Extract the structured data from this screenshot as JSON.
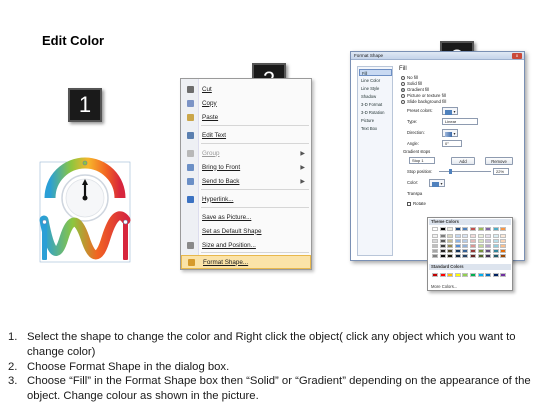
{
  "title": "Edit Color",
  "markers": [
    "1",
    "2",
    "3"
  ],
  "context_menu": {
    "items": [
      {
        "label": "Cut",
        "icon": "scissors-icon",
        "color": "#6d6d6d",
        "disabled": false
      },
      {
        "label": "Copy",
        "icon": "copy-icon",
        "color": "#7b93c6",
        "disabled": false
      },
      {
        "label": "Paste",
        "icon": "paste-icon",
        "color": "#caa64a",
        "disabled": false
      },
      {
        "label": "Edit Text",
        "icon": "edit-text-icon",
        "color": "#5a7fb0",
        "disabled": false
      },
      {
        "label": "Group",
        "icon": "group-icon",
        "color": "#b8b8b8",
        "disabled": true,
        "submenu": true
      },
      {
        "label": "Bring to Front",
        "icon": "bring-to-front-icon",
        "color": "#6b8fc6",
        "disabled": false,
        "submenu": true
      },
      {
        "label": "Send to Back",
        "icon": "send-to-back-icon",
        "color": "#6b8fc6",
        "disabled": false,
        "submenu": true
      },
      {
        "label": "Hyperlink...",
        "icon": "hyperlink-icon",
        "color": "#3b72c2",
        "disabled": false
      },
      {
        "label": "Save as Picture...",
        "icon": "",
        "color": "",
        "disabled": false
      },
      {
        "label": "Set as Default Shape",
        "icon": "",
        "color": "",
        "disabled": false
      },
      {
        "label": "Size and Position...",
        "icon": "size-position-icon",
        "color": "#8a8a8a",
        "disabled": false
      },
      {
        "label": "Format Shape...",
        "icon": "format-shape-icon",
        "color": "#d69a2c",
        "disabled": false,
        "highlighted": true
      }
    ]
  },
  "format_dialog": {
    "title": "Format Shape",
    "close_label": "x",
    "nav": [
      "Fill",
      "Line Color",
      "Line Style",
      "Shadow",
      "3-D Format",
      "3-D Rotation",
      "Picture",
      "Text Box"
    ],
    "section_title": "Fill",
    "fill_options": [
      {
        "label": "No fill",
        "checked": false
      },
      {
        "label": "Solid fill",
        "checked": false
      },
      {
        "label": "Gradient fill",
        "checked": true
      },
      {
        "label": "Picture or texture fill",
        "checked": false
      },
      {
        "label": "Slide background fill",
        "checked": false
      }
    ],
    "preset_colors_label": "Preset colors:",
    "type_label": "Type:",
    "type_value": "Linear",
    "direction_label": "Direction:",
    "angle_label": "Angle:",
    "angle_value": "0°",
    "gradient_stops_label": "Gradient stops",
    "stop_value": "Stop 1",
    "add_label": "Add",
    "remove_label": "Remove",
    "stop_position_label": "Stop position:",
    "stop_position_value": "22%",
    "color_label": "Color:",
    "transparency_label": "Transpa",
    "rotate_label": "Rotate",
    "accent": "#4f81bd"
  },
  "palette": {
    "theme_title": "Theme Colors",
    "standard_title": "Standard Colors",
    "more_label": "More Colors...",
    "theme_top": [
      "#ffffff",
      "#000000",
      "#eeece1",
      "#1f497d",
      "#4f81bd",
      "#c0504d",
      "#9bbb59",
      "#8064a2",
      "#4bacc6",
      "#f79646"
    ],
    "theme_shades": [
      [
        "#f2f2f2",
        "#7f7f7f",
        "#ddd9c3",
        "#c6d9f0",
        "#dbe5f1",
        "#f2dcdb",
        "#ebf1dd",
        "#e5e0ec",
        "#dbeef3",
        "#fdeada"
      ],
      [
        "#d8d8d8",
        "#595959",
        "#c4bd97",
        "#8db3e2",
        "#b8cce4",
        "#e5b9b7",
        "#d7e3bc",
        "#ccc1d9",
        "#b7dde8",
        "#fbd5b5"
      ],
      [
        "#bfbfbf",
        "#3f3f3f",
        "#938953",
        "#548dd4",
        "#95b3d7",
        "#d99694",
        "#c3d69b",
        "#b2a2c7",
        "#92cddc",
        "#fac08f"
      ],
      [
        "#a5a5a5",
        "#262626",
        "#494429",
        "#17365d",
        "#366092",
        "#953734",
        "#76923c",
        "#5f497a",
        "#31859b",
        "#e36c09"
      ],
      [
        "#7f7f7f",
        "#0c0c0c",
        "#1d1b10",
        "#0f243e",
        "#244061",
        "#632423",
        "#4f6128",
        "#3f3151",
        "#205867",
        "#974806"
      ]
    ],
    "standard": [
      "#c00000",
      "#ff0000",
      "#ffc000",
      "#ffff00",
      "#92d050",
      "#00b050",
      "#00b0f0",
      "#0070c0",
      "#002060",
      "#7030a0"
    ]
  },
  "steps": [
    {
      "num": "1.",
      "text": "Select the shape to change the color and Right click the object( click any object which you want to change color)"
    },
    {
      "num": "2.",
      "text": "Choose Format Shape in the dialog box."
    },
    {
      "num": "3.",
      "text": "Choose “Fill” in the Format Shape box then “Solid” or “Gradient” depending on the appearance of the object. Change colour as shown in the picture."
    }
  ]
}
